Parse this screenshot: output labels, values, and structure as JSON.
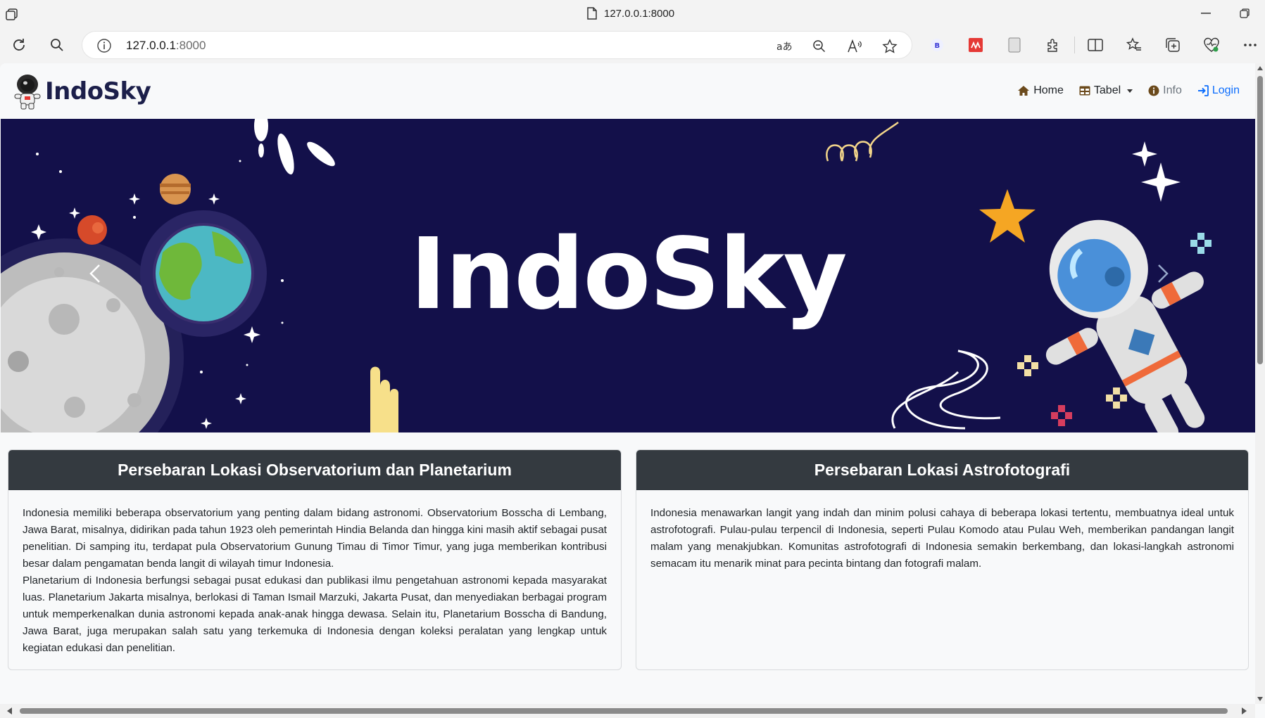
{
  "browser": {
    "tab_title": "127.0.0.1:8000",
    "url_host": "127.0.0.1",
    "url_port": ":8000",
    "extension_badge": "B"
  },
  "site": {
    "brand": "IndoSky",
    "nav": {
      "home": "Home",
      "tabel": "Tabel",
      "info": "Info",
      "login": "Login"
    },
    "hero_title": "IndoSky"
  },
  "cards": [
    {
      "title": "Persebaran Lokasi Observatorium dan Planetarium",
      "paragraphs": [
        "Indonesia memiliki beberapa observatorium yang penting dalam bidang astronomi. Observatorium Bosscha di Lembang, Jawa Barat, misalnya, didirikan pada tahun 1923 oleh pemerintah Hindia Belanda dan hingga kini masih aktif sebagai pusat penelitian. Di samping itu, terdapat pula Observatorium Gunung Timau di Timor Timur, yang juga memberikan kontribusi besar dalam pengamatan benda langit di wilayah timur Indonesia.",
        "Planetarium di Indonesia berfungsi sebagai pusat edukasi dan publikasi ilmu pengetahuan astronomi kepada masyarakat luas. Planetarium Jakarta misalnya, berlokasi di Taman Ismail Marzuki, Jakarta Pusat, dan menyediakan berbagai program untuk memperkenalkan dunia astronomi kepada anak-anak hingga dewasa. Selain itu, Planetarium Bosscha di Bandung, Jawa Barat, juga merupakan salah satu yang terkemuka di Indonesia dengan koleksi peralatan yang lengkap untuk kegiatan edukasi dan penelitian."
      ]
    },
    {
      "title": "Persebaran Lokasi Astrofotografi",
      "paragraphs": [
        "Indonesia menawarkan langit yang indah dan minim polusi cahaya di beberapa lokasi tertentu, membuatnya ideal untuk astrofotografi. Pulau-pulau terpencil di Indonesia, seperti Pulau Komodo atau Pulau Weh, memberikan pandangan langit malam yang menakjubkan. Komunitas astrofotografi di Indonesia semakin berkembang, dan lokasi-langkah astronomi semacam itu menarik minat para pecinta bintang dan fotografi malam."
      ]
    }
  ],
  "colors": {
    "hero_bg": "#13104a",
    "card_header": "#343a40",
    "link_primary": "#0d6efd",
    "brand_text": "#1c1f4a"
  }
}
